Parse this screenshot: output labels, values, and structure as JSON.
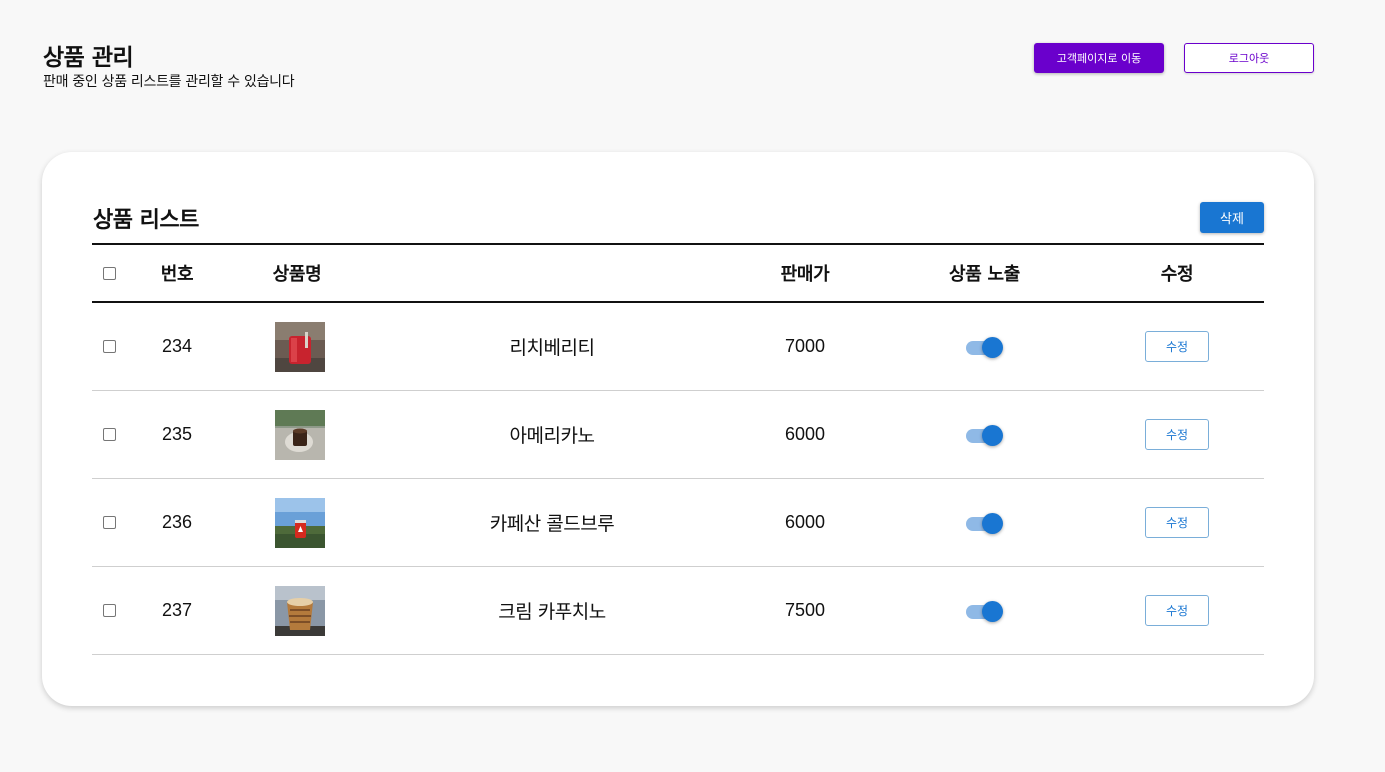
{
  "header": {
    "title": "상품 관리",
    "subtitle": "판매 중인 상품 리스트를 관리할 수 있습니다",
    "customer_page_label": "고객페이지로 이동",
    "logout_label": "로그아웃"
  },
  "product_list": {
    "title": "상품 리스트",
    "delete_label": "삭제",
    "columns": [
      "번호",
      "상품명",
      "판매가",
      "상품 노출",
      "수정"
    ],
    "rows": [
      {
        "number": "234",
        "name": "리치베리티",
        "price": "7000",
        "exposed": true,
        "edit_label": "수정",
        "thumb_icon": "red-tea-drink-photo"
      },
      {
        "number": "235",
        "name": "아메리카노",
        "price": "6000",
        "exposed": true,
        "edit_label": "수정",
        "thumb_icon": "americano-cup-photo"
      },
      {
        "number": "236",
        "name": "카페산 콜드브루",
        "price": "6000",
        "exposed": true,
        "edit_label": "수정",
        "thumb_icon": "cold-brew-can-photo"
      },
      {
        "number": "237",
        "name": "크림 카푸치노",
        "price": "7500",
        "exposed": true,
        "edit_label": "수정",
        "thumb_icon": "cappuccino-cup-photo"
      }
    ]
  },
  "colors": {
    "primary_purple": "#6a00cc",
    "primary_blue": "#1976d2",
    "background": "#f8f8f8"
  }
}
